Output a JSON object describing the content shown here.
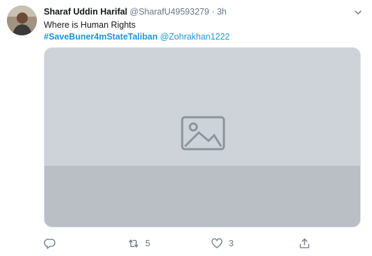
{
  "tweet": {
    "display_name": "Sharaf Uddin Harifal",
    "handle": "@SharafU49593279",
    "separator": "·",
    "time": "3h",
    "text_line": "Where is Human Rights",
    "hashtag": "#SaveBuner4mStateTaliban",
    "mention": "@Zohrakhan1222",
    "media": {
      "alt": "Photo attached to the tweet (placeholder)"
    },
    "actions": {
      "reply_icon": "reply-icon",
      "retweet_icon": "retweet-icon",
      "retweet_count": "5",
      "like_icon": "heart-icon",
      "like_count": "3",
      "share_icon": "share-icon"
    },
    "colors": {
      "link": "#1b95e0",
      "secondary_text": "#657786",
      "primary_text": "#14171a"
    }
  }
}
